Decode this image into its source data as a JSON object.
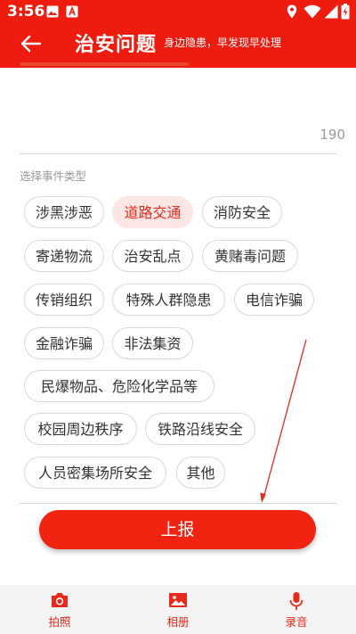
{
  "status_bar": {
    "time": "3:56"
  },
  "header": {
    "title": "治安问题",
    "subtitle": "身边隐患，早发现早处理"
  },
  "description": {
    "char_count": "190"
  },
  "event_types": {
    "label": "选择事件类型",
    "selected": "道路交通",
    "options": [
      "涉黑涉恶",
      "道路交通",
      "消防安全",
      "寄递物流",
      "治安乱点",
      "黄赌毒问题",
      "传销组织",
      "特殊人群隐患",
      "电信诈骗",
      "金融诈骗",
      "非法集资",
      "民爆物品、危险化学品等",
      "校园周边秩序",
      "铁路沿线安全",
      "人员密集场所安全",
      "其他"
    ]
  },
  "submit_label": "上报",
  "bottom_bar": [
    {
      "label": "拍照",
      "icon": "camera-icon"
    },
    {
      "label": "相册",
      "icon": "image-icon"
    },
    {
      "label": "录音",
      "icon": "microphone-icon"
    }
  ],
  "colors": {
    "primary": "#ee1b0f",
    "selected_bg": "#fde6e4",
    "selected_text": "#e8291c"
  }
}
